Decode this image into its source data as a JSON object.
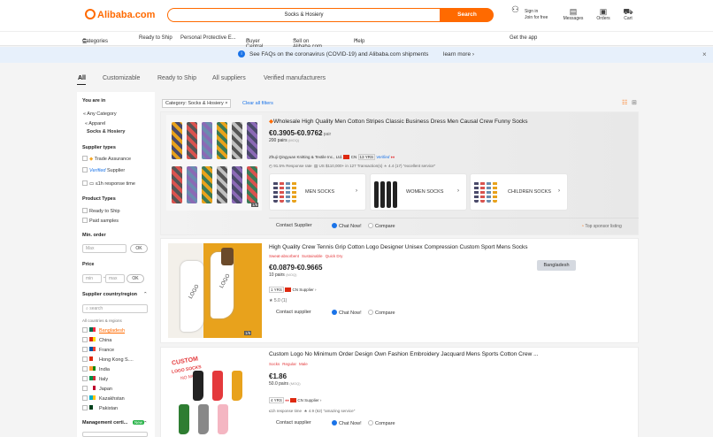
{
  "header": {
    "logo": "Alibaba.com",
    "search_value": "Socks & Hosiery",
    "search_button": "Search",
    "signin": "Sign in",
    "join": "Join for free",
    "messages": "Messages",
    "orders": "Orders",
    "cart": "Cart"
  },
  "nav": {
    "categories": "Categories",
    "items": [
      "Ready to Ship",
      "Personal Protective E...",
      "Buyer Central",
      "Sell on Alibaba.com",
      "Help"
    ],
    "get_app": "Get the app"
  },
  "banner": {
    "text": "See FAQs on the coronavirus (COVID-19) and Alibaba.com shipments",
    "link": "learn more"
  },
  "tabs": [
    "All",
    "Customizable",
    "Ready to Ship",
    "All suppliers",
    "Verified manufacturers"
  ],
  "sidebar": {
    "you_are_in": "You are in",
    "any": "« Any Category",
    "apparel": "« Apparel",
    "current": "Socks & Hosiery",
    "supplier_types": "Supplier types",
    "trade_assurance": "Trade Assurance",
    "verified": "Verified",
    "verified_supplier": "Supplier",
    "response": "≤1h response time",
    "product_types": "Product Types",
    "ready": "Ready to Ship",
    "paid": "Paid samples",
    "min_order": "Min. order",
    "max_ph": "Max",
    "ok": "OK",
    "price": "Price",
    "min_ph": "min",
    "max2_ph": "max",
    "country": "Supplier country/region",
    "search_ph": "search",
    "all_countries": "All countries & regions",
    "countries": [
      "Bangladesh",
      "China",
      "France",
      "Hong Kong S....",
      "India",
      "Italy",
      "Japan",
      "Kazakhstan",
      "Pakistan"
    ],
    "mgmt": "Management certi...",
    "mgmt_badge": "New"
  },
  "filter": {
    "chip": "Category: Socks & Hosiery",
    "clear": "Clear all filters"
  },
  "product1": {
    "title": "Wholesale High Quality Men Cotton Stripes Classic Business Dress Men Causal Crew Funny Socks",
    "price": "€0.3905-€0.9762",
    "per": "/ pair",
    "moq": "200 pairs",
    "moq_unit": "(MOQ)",
    "supplier": "Zhuji Qingyuan Knitting & Textile Inc., Ltd.",
    "country": "CN",
    "years": "13 YRS",
    "verified": "Verified",
    "rate": "91.5% Response rate",
    "trans": "US $110,000+ in 127 Transaction(s)",
    "rating": "4.4 (17)",
    "review": "\"excellent service\"",
    "img_count": "1/6",
    "sub": [
      "MEN SOCKS",
      "WOMEN SOCKS",
      "CHILDREN SOCKS"
    ],
    "contact": "Contact Supplier",
    "chat": "Chat Now!",
    "compare": "Compare",
    "sponsor": "Top sponsor listing"
  },
  "product2": {
    "title": "High Quality Crew Tennis Grip Cotton Logo Designer Unisex Compression Custom Sport Mens Socks",
    "tags": [
      "Sweat-absorbent",
      "Sustainable",
      "Quick Dry"
    ],
    "price": "€0.0879-€0.9665",
    "moq": "10 pairs",
    "moq_unit": "(MOQ)",
    "years": "1 YRS",
    "supplier": "CN Supplier",
    "rating": "5.0 (1)",
    "contact": "Contact supplier",
    "chat": "Chat Now!",
    "compare": "Compare",
    "badge": "Bangladesh",
    "img_count": "1/6",
    "logo": "LOGO"
  },
  "product3": {
    "title": "Custom Logo No Minimum Order Design Own Fashion Embroidery Jacquard Mens Sports Cotton Crew ...",
    "tags": [
      "Socks",
      "Regular",
      "Male"
    ],
    "price": "€1.86",
    "moq": "50.0 pairs",
    "moq_unit": "(MOQ)",
    "years": "4 YRS",
    "supplier": "CN Supplier",
    "resp": "≤1h response time",
    "rating": "4.9 (62)",
    "review": "\"amazing service\"",
    "contact": "Contact supplier",
    "chat": "Chat Now!",
    "compare": "Compare",
    "custom": "CUSTOM",
    "logo": "LOGO SOCKS",
    "nomoq": "NO MOQ !!!"
  }
}
